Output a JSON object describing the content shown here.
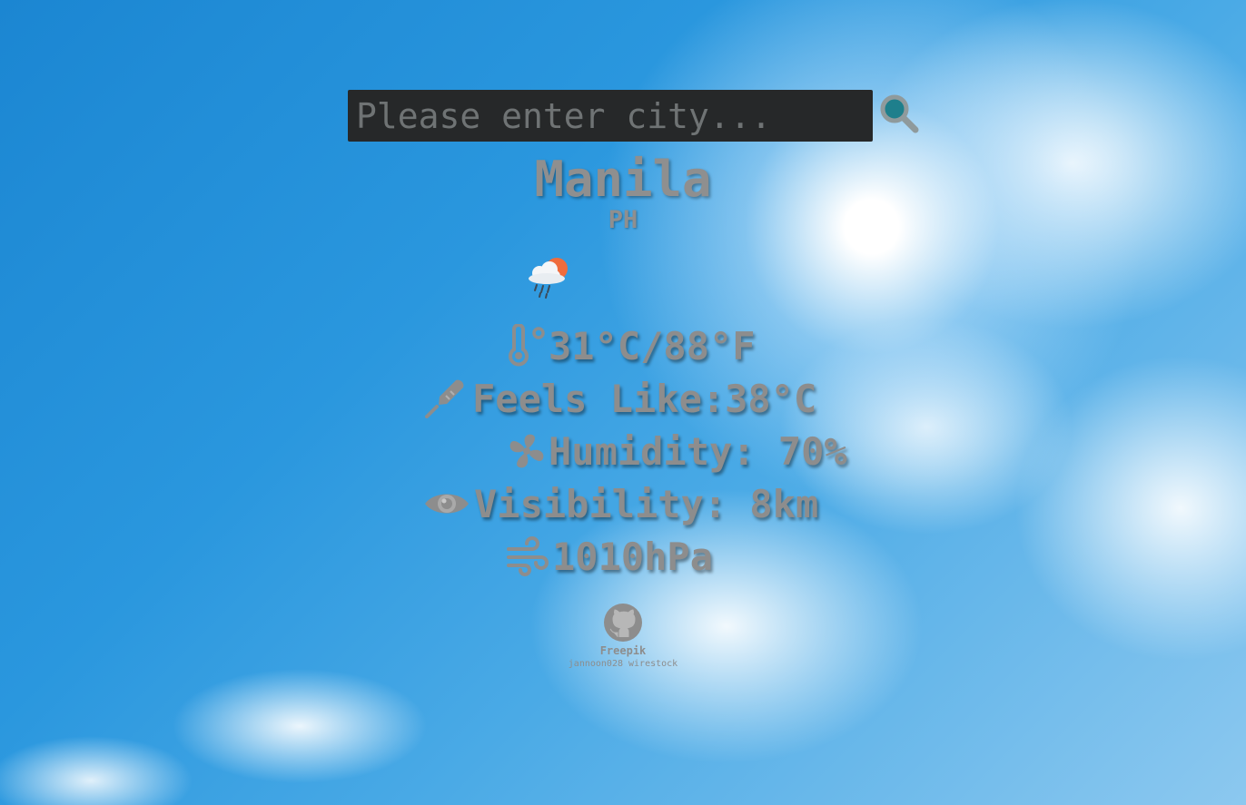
{
  "search": {
    "placeholder": "Please enter city...",
    "value": ""
  },
  "location": {
    "city": "Manila",
    "country": "PH"
  },
  "weather": {
    "icon": "sun-behind-rain-cloud-icon",
    "temperature": "31°C/88°F",
    "feels_like": "Feels Like:38°C",
    "humidity": "Humidity: 70%",
    "visibility": "Visibility: 8km",
    "pressure": "1010hPa"
  },
  "footer": {
    "icon": "github-icon",
    "credit": "Freepik",
    "authors": "jannoon028  wirestock"
  },
  "colors": {
    "search_bg": "#262829",
    "text": "#8d8d8d",
    "search_icon_lens": "#1e7f8c",
    "sun_accent": "#ef6c3d"
  }
}
